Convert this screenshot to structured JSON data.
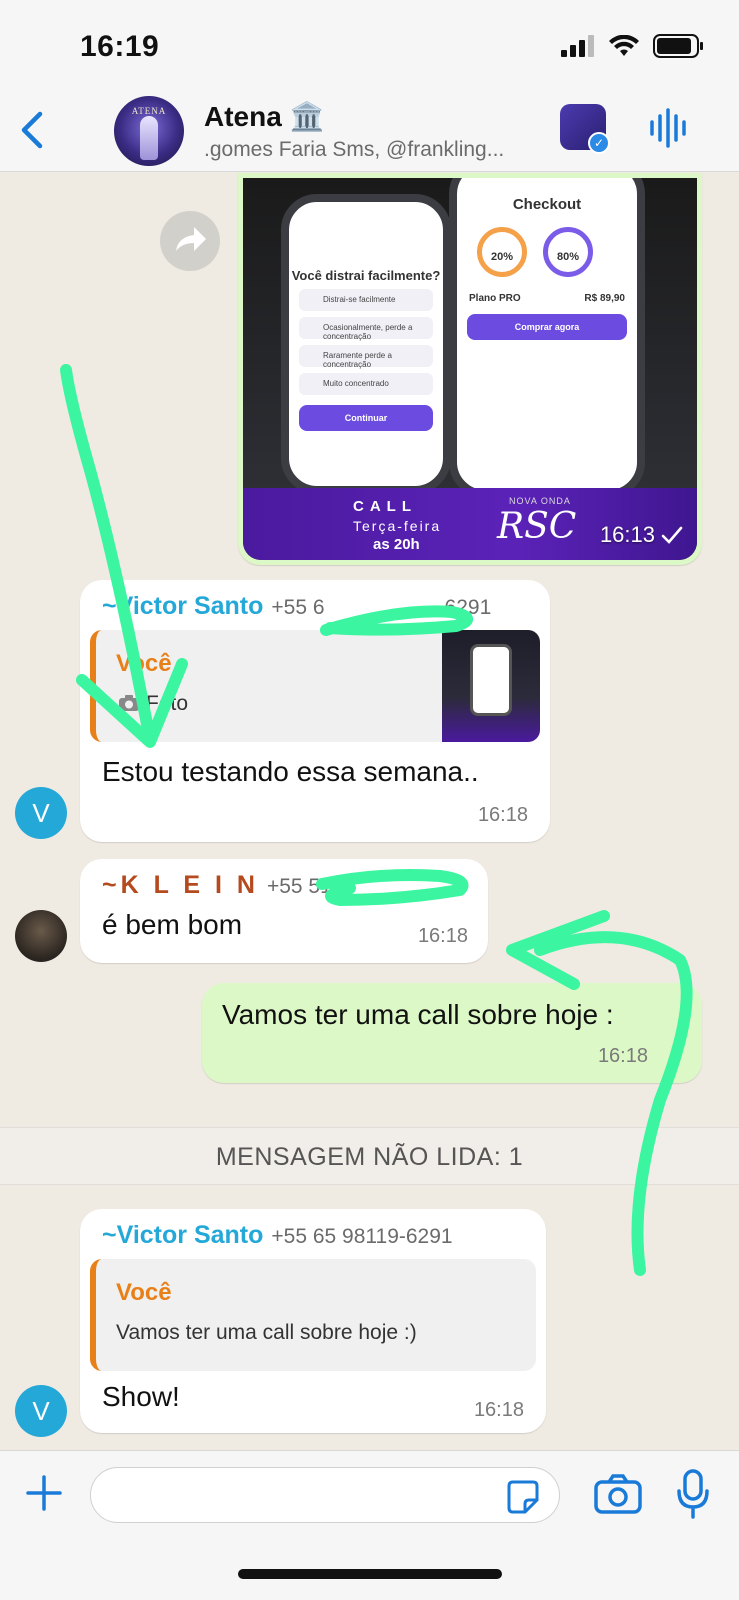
{
  "status": {
    "time": "16:19"
  },
  "header": {
    "back_label": "<",
    "title": "Atena 🏛️",
    "subtitle": ".gomes Faria Sms, @frankling...",
    "avatar_text": "ATENA"
  },
  "image_message": {
    "screen_left_title": "Você distrai facilmente?",
    "screen_left_options": [
      "Distrai-se facilmente",
      "Ocasionalmente, perde a concentração",
      "Raramente perde a concentração",
      "Muito concentrado"
    ],
    "screen_left_button": "Continuar",
    "screen_right_title": "Checkout",
    "ring_1": "20%",
    "ring_2": "80%",
    "plan_name": "Plano PRO",
    "plan_price": "R$ 89,90",
    "buy_button": "Comprar agora",
    "banner_call": "CALL",
    "banner_day": "Terça-feira",
    "banner_hour": "as 20h",
    "banner_nova": "NOVA ONDA",
    "banner_rsc": "RSC",
    "time": "16:13"
  },
  "msg1": {
    "sender": "~Victor Santo",
    "phone": "+55 6",
    "phone_end": "6291",
    "quote_name": "Você",
    "quote_text": "Foto",
    "text": "Estou testando essa semana..",
    "time": "16:18",
    "avatar": "V"
  },
  "msg2": {
    "sender": "~K L E I N",
    "phone": "+55 51",
    "text": "é bem bom",
    "time": "16:18"
  },
  "msg3": {
    "text": "Vamos ter uma call sobre hoje :",
    "time": "16:18"
  },
  "unread_label": "MENSAGEM NÃO LIDA: 1",
  "msg4": {
    "sender": "~Victor Santo",
    "phone": "+55 65 98119-6291",
    "quote_name": "Você",
    "quote_text": "Vamos ter uma call sobre hoje :)",
    "text": "Show!",
    "time": "16:18",
    "avatar": "V"
  },
  "colors": {
    "accent_blue": "#1a7ad8",
    "sender_victor": "#24a8d8",
    "sender_klein": "#b54a1f",
    "quote_orange": "#e8801a",
    "outgoing": "#dcf8c6",
    "annotation_green": "#3cf5a0"
  }
}
